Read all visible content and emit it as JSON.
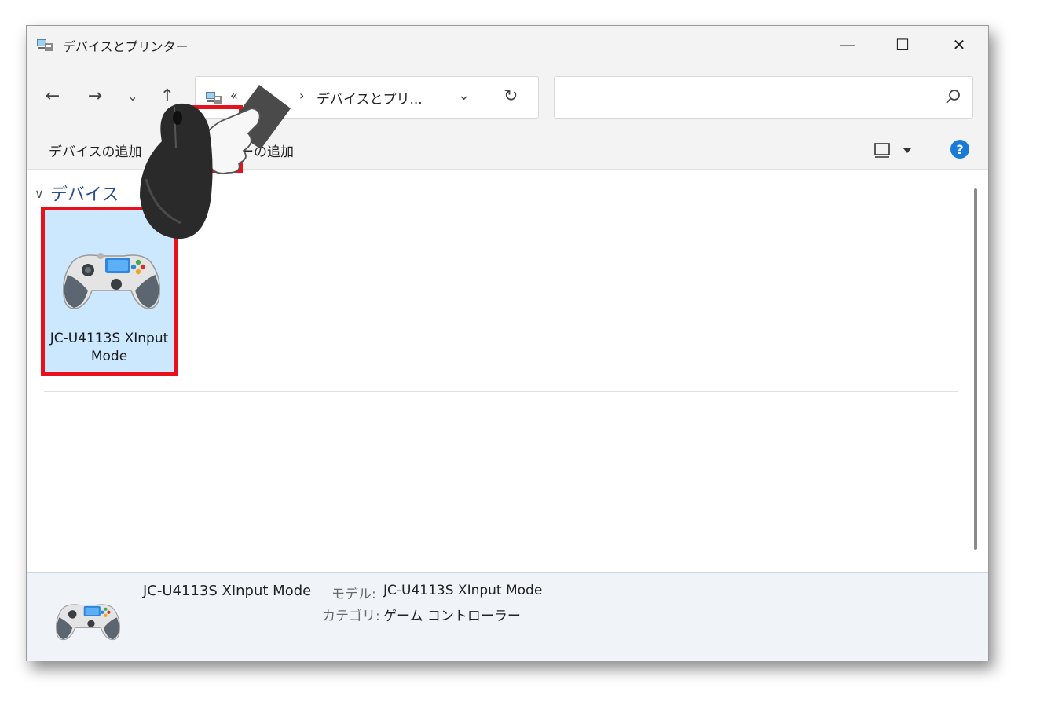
{
  "window": {
    "title": "デバイスとプリンター",
    "minimize_glyph": "—",
    "maximize_glyph": "☐",
    "close_glyph": "✕"
  },
  "nav": {
    "back_glyph": "←",
    "forward_glyph": "→",
    "recent_glyph": "⌄",
    "up_glyph": "↑"
  },
  "address": {
    "ellipsis": "«",
    "separator": "›",
    "crumb": "デバイスとプリ...",
    "dropdown_glyph": "⌄",
    "refresh_glyph": "↻"
  },
  "search": {
    "placeholder": ""
  },
  "commands": {
    "add_device": "デバイスの追加",
    "add_printer": "プリンターの追加",
    "help": "?"
  },
  "group": {
    "chevron": "∨",
    "label": "デバイス"
  },
  "devices": [
    {
      "name": "JC-U4113S XInput Mode",
      "icon": "gamepad-icon"
    }
  ],
  "details": {
    "name": "JC-U4113S XInput Mode",
    "model_label": "モデル:",
    "model_value": "JC-U4113S XInput Mode",
    "category_label": "カテゴリ:",
    "category_value": "ゲーム コントローラー"
  },
  "colors": {
    "accent": "#1a7ad8",
    "selection": "#cce8ff",
    "highlight": "#e8101a",
    "group_text": "#2a4f8e"
  }
}
